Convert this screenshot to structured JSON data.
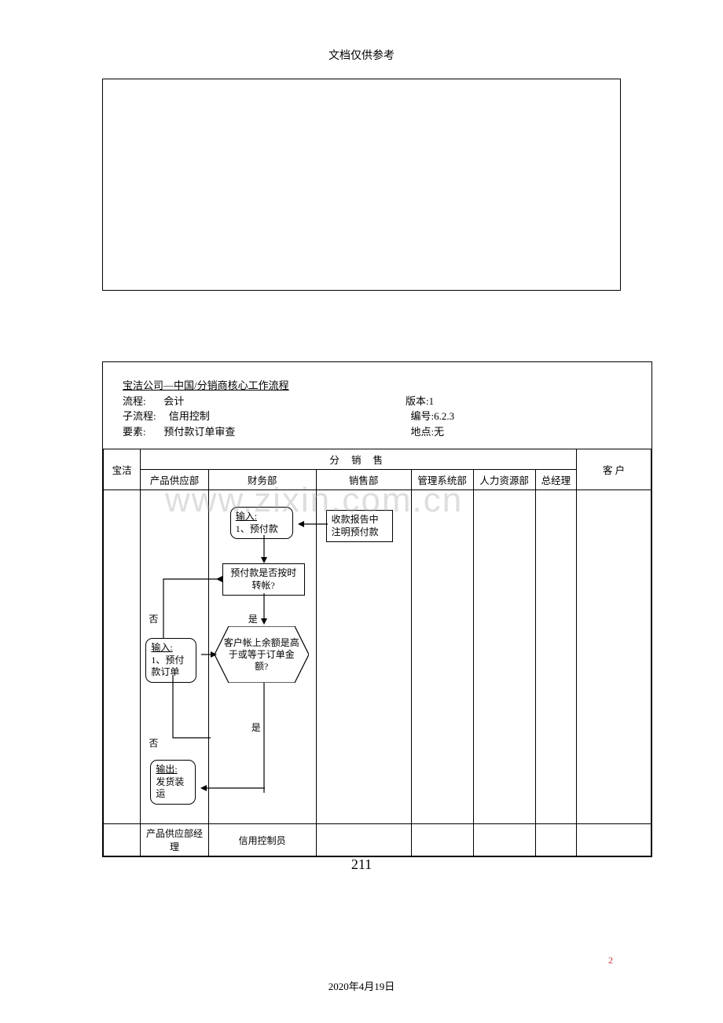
{
  "header": "文档仅供参考",
  "titleBlock": {
    "line1": "宝洁公司—中国/分销商核心工作流程",
    "process_label": "流程:",
    "process_value": "会计",
    "version_label": "版本:",
    "version_value": "1",
    "subprocess_label": "子流程:",
    "subprocess_value": "信用控制",
    "id_label": "编号:",
    "id_value": "6.2.3",
    "element_label": "要素:",
    "element_value": "预付款订单审查",
    "location_label": "地点:",
    "location_value": "无"
  },
  "columns": {
    "col0": "宝洁",
    "group": "分  销  售",
    "col1": "产品供应部",
    "col2": "财务部",
    "col3": "销售部",
    "col4": "管理系统部",
    "col5": "人力资源部",
    "col6": "总经理",
    "col7": "客    户"
  },
  "nodes": {
    "input1_label": "输入:",
    "input1_text": "1、预付款",
    "note_box": "收款报告中注明预付款",
    "decision1": "预付款是否按时转帐?",
    "input2_label": "输入:",
    "input2_text": "1、预付款订单",
    "decision2": "客户帐上余额是高于或等于订单金额?",
    "output_label": "输出:",
    "output_text": "发货装运",
    "no": "否",
    "yes": "是"
  },
  "footer": {
    "role1": "产品供应部经理",
    "role2": "信用控制员"
  },
  "pageNumber": "211",
  "smallPageNum": "2",
  "date": "2020年4月19日",
  "watermark": "www.zixin.com.cn"
}
